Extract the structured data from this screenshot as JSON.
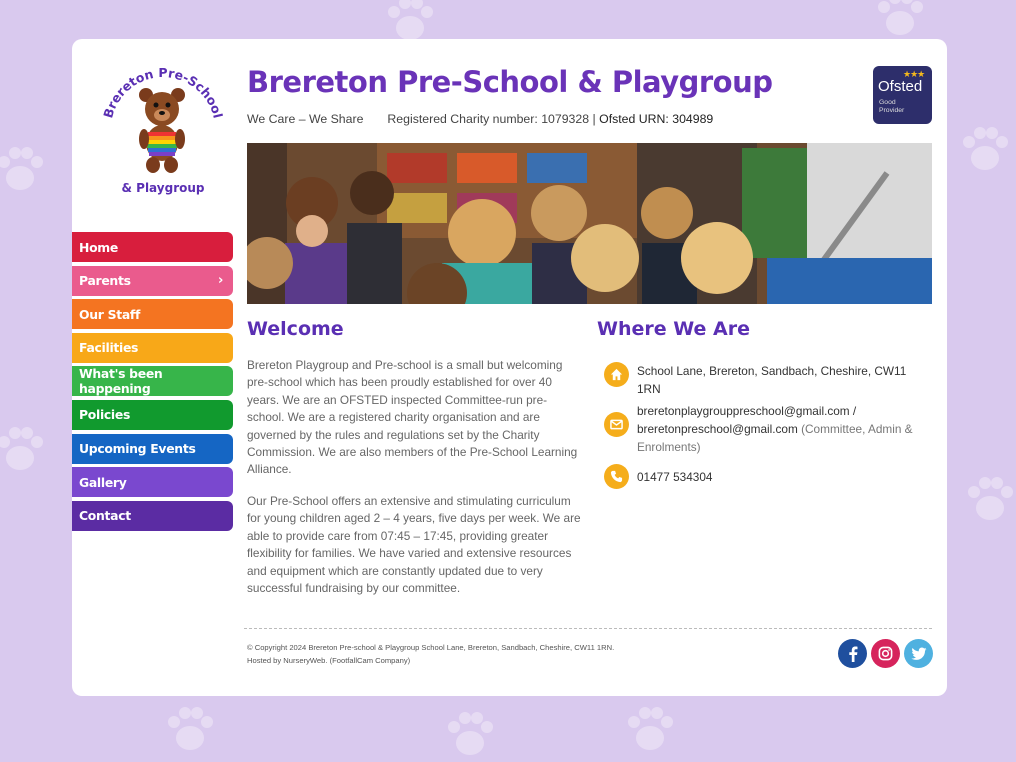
{
  "site": {
    "title": "Brereton Pre-School & Playgroup",
    "tagline": "We Care – We Share",
    "charity": "Registered Charity number: 1079328",
    "separator": "|",
    "urn": "Ofsted URN: 304989"
  },
  "logo": {
    "arc_text": "Brereton Pre-School",
    "bottom_text": "& Playgroup"
  },
  "ofsted": {
    "word": "Ofsted",
    "grade_line1": "Good",
    "grade_line2": "Provider",
    "stars": "★★★"
  },
  "nav": {
    "items": [
      {
        "label": "Home",
        "color": "#d81e3d"
      },
      {
        "label": "Parents",
        "color": "#ea5b8d",
        "chevron": "›"
      },
      {
        "label": "Our Staff",
        "color": "#f47421"
      },
      {
        "label": "Facilities",
        "color": "#f8a818"
      },
      {
        "label": "What's been happening",
        "color": "#37b54a"
      },
      {
        "label": "Policies",
        "color": "#119a2e"
      },
      {
        "label": "Upcoming Events",
        "color": "#1566c4"
      },
      {
        "label": "Gallery",
        "color": "#7a48cf"
      },
      {
        "label": "Contact",
        "color": "#5b2ca3"
      }
    ]
  },
  "welcome": {
    "heading": "Welcome",
    "p1": "Brereton Playgroup and Pre-school is a small but welcoming pre-school which has been proudly established for over 40 years. We are an OFSTED inspected Committee-run pre-school. We are a registered charity organisation and are governed by the rules and regulations set by the Charity Commission. We are also members of the Pre-School Learning Alliance.",
    "p2": "Our Pre-School offers an extensive and stimulating curriculum for young children aged 2 – 4 years, five days per week. We are able to provide care from 07:45 – 17:45, providing greater flexibility for families. We have varied and extensive resources and equipment which are constantly updated due to very successful fundraising by our committee."
  },
  "where": {
    "heading": "Where We Are",
    "address": "School Lane, Brereton, Sandbach, Cheshire, CW11 1RN",
    "email1": "breretonplaygrouppreschool@gmail.com /",
    "email2": "breretonpreschool@gmail.com",
    "email_note": " (Committee, Admin & Enrolments)",
    "phone": "01477 534304"
  },
  "footer": {
    "copyright": "© Copyright 2024 Brereton Pre-school & Playgroup School Lane, Brereton, Sandbach, Cheshire, CW11 1RN.",
    "hosted": "Hosted by NurseryWeb. (FootfallCam Company)"
  },
  "social": {
    "facebook_color": "#1f4f9e",
    "instagram_color": "#d6245c",
    "twitter_color": "#4fb1e0",
    "icons": [
      "facebook-icon",
      "instagram-icon",
      "twitter-icon"
    ]
  }
}
